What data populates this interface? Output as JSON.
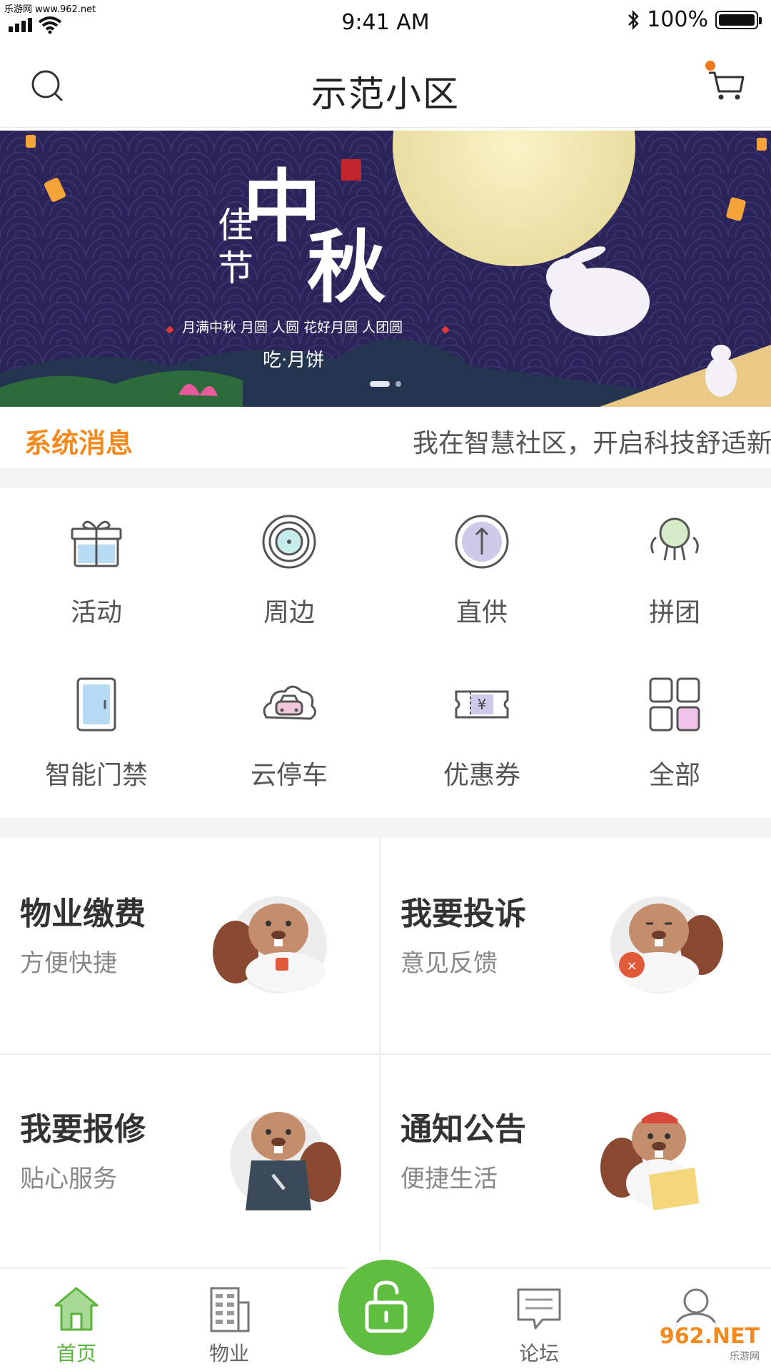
{
  "status_bar": {
    "watermark": "乐游网 www.962.net",
    "time": "9:41 AM",
    "battery": "100%",
    "battery_level": 1.0
  },
  "header": {
    "title": "示范小区",
    "search_icon": "search-icon",
    "cart_icon": "cart-icon",
    "cart_badge_color": "#f07a1a"
  },
  "banner": {
    "title_big": "中秋",
    "title_small": "佳节",
    "line1": "月满中秋 月圆 人圆 花好月圆 人团圆",
    "line2": "吃·月饼",
    "dots_total": 2,
    "dots_active": 1
  },
  "notice": {
    "label": "系统消息",
    "text": "我在智慧社区，开启科技舒适新"
  },
  "grid": {
    "items": [
      {
        "label": "活动",
        "icon": "gift-icon"
      },
      {
        "label": "周边",
        "icon": "target-icon"
      },
      {
        "label": "直供",
        "icon": "arrow-up-icon"
      },
      {
        "label": "拼团",
        "icon": "group-icon"
      },
      {
        "label": "智能门禁",
        "icon": "door-icon"
      },
      {
        "label": "云停车",
        "icon": "car-cloud-icon"
      },
      {
        "label": "优惠券",
        "icon": "coupon-icon"
      },
      {
        "label": "全部",
        "icon": "grid-icon"
      }
    ]
  },
  "cards": [
    {
      "title": "物业缴费",
      "subtitle": "方便快捷"
    },
    {
      "title": "我要投诉",
      "subtitle": "意见反馈"
    },
    {
      "title": "我要报修",
      "subtitle": "贴心服务"
    },
    {
      "title": "通知公告",
      "subtitle": "便捷生活"
    }
  ],
  "tabbar": {
    "home": "首页",
    "property": "物业",
    "forum": "论坛",
    "center_icon": "unlock-icon",
    "active_color": "#5ab33a"
  },
  "watermark_bottom": {
    "brand": "962.NET",
    "sub": "乐游网"
  }
}
